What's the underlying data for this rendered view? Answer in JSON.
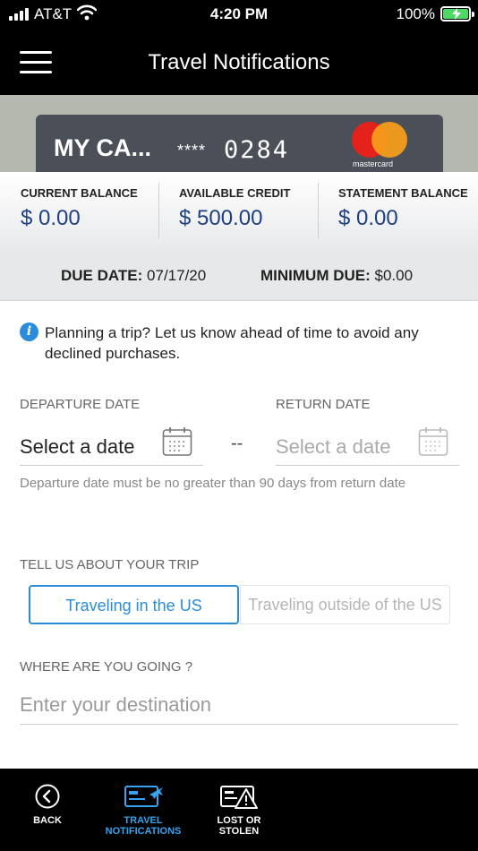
{
  "status_bar": {
    "carrier": "AT&T",
    "time": "4:20 PM",
    "battery": "100%"
  },
  "header": {
    "title": "Travel Notifications"
  },
  "card": {
    "name": "MY CA...",
    "mask": "****",
    "last4": "0284",
    "network": "mastercard"
  },
  "balances": [
    {
      "label": "CURRENT BALANCE",
      "value": "$ 0.00"
    },
    {
      "label": "AVAILABLE CREDIT",
      "value": "$ 500.00"
    },
    {
      "label": "STATEMENT BALANCE",
      "value": "$ 0.00"
    }
  ],
  "due": {
    "due_date_label": "DUE DATE:",
    "due_date_value": "07/17/20",
    "minimum_due_label": "MINIMUM DUE:",
    "minimum_due_value": "$0.00"
  },
  "info": {
    "text": "Planning a trip? Let us know ahead of time to avoid any declined purchases."
  },
  "dates": {
    "departure_label": "DEPARTURE DATE",
    "departure_value": "Select a date",
    "return_label": "RETURN DATE",
    "return_value": "Select a date",
    "separator": "--",
    "hint": "Departure date must be no greater than 90 days from return date"
  },
  "trip": {
    "label": "TELL US ABOUT YOUR TRIP",
    "options": [
      "Traveling in the US",
      "Traveling outside of the US"
    ],
    "selected": "Traveling in the US"
  },
  "destination": {
    "label": "WHERE ARE YOU GOING ?",
    "placeholder": "Enter your destination",
    "value": ""
  },
  "tabbar": {
    "back": "BACK",
    "travel_line1": "TRAVEL",
    "travel_line2": "NOTIFICATIONS",
    "lost_line1": "LOST OR",
    "lost_line2": "STOLEN"
  },
  "colors": {
    "accent": "#2a8cdb",
    "tab_active": "#36a3f0",
    "balance_value": "#1e3f80",
    "battery": "#4cd964"
  }
}
